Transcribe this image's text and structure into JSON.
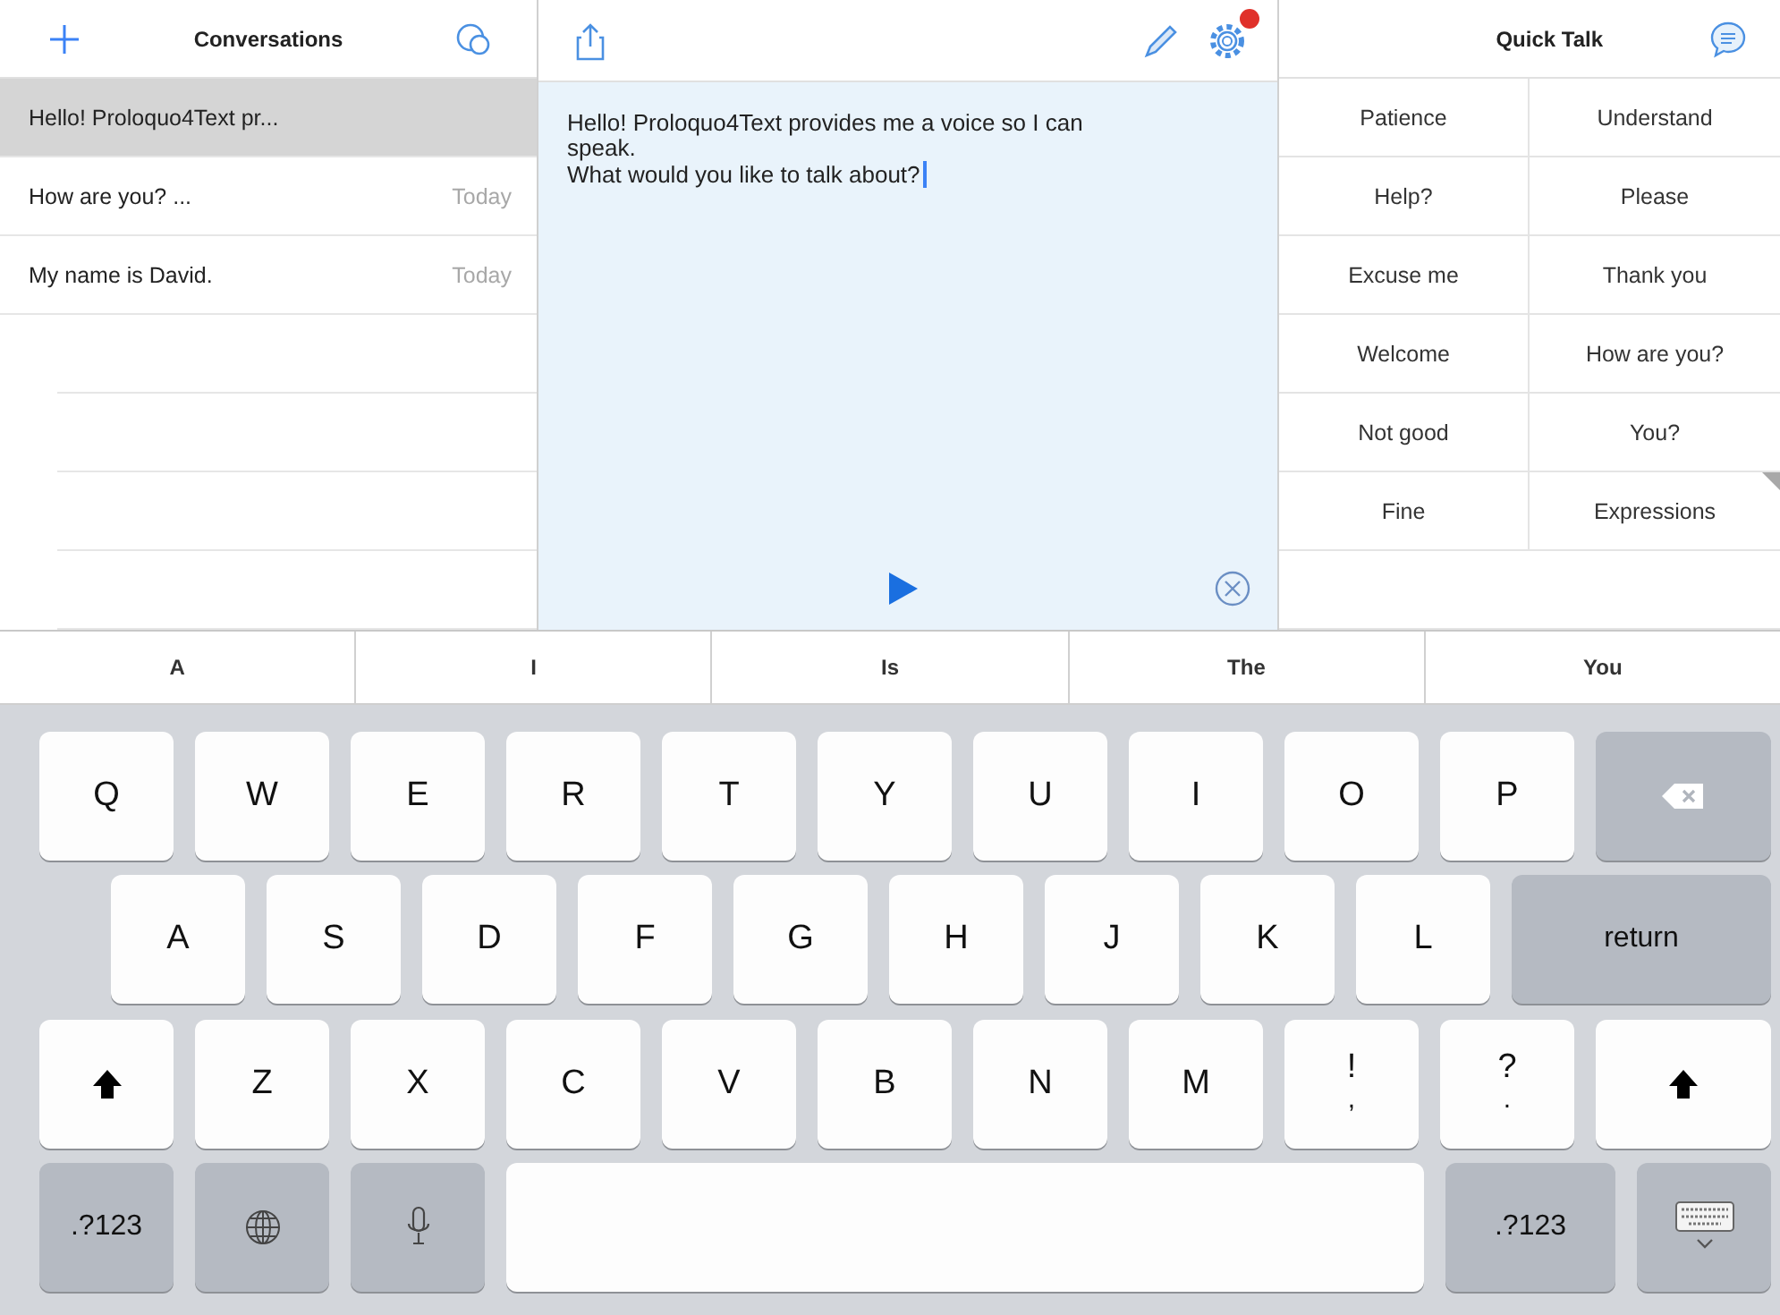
{
  "conversations_panel": {
    "title": "Conversations",
    "items": [
      {
        "text": "Hello! Proloquo4Text pr...",
        "selected": true
      },
      {
        "text": "How are you? ...",
        "date": "Today",
        "selected": false
      },
      {
        "text": "My name is David.",
        "date": "Today",
        "selected": false
      }
    ]
  },
  "editor": {
    "lines": [
      "Hello! Proloquo4Text provides me a voice so I can speak.",
      "What would you like to talk about?"
    ],
    "settings_badge": true
  },
  "quick_talk": {
    "title": "Quick Talk",
    "items": [
      {
        "label": "Patience",
        "kind": "phrase"
      },
      {
        "label": "Understand",
        "kind": "phrase"
      },
      {
        "label": "Help?",
        "kind": "phrase"
      },
      {
        "label": "Please",
        "kind": "phrase"
      },
      {
        "label": "Excuse me",
        "kind": "phrase"
      },
      {
        "label": "Thank you",
        "kind": "phrase"
      },
      {
        "label": "Welcome",
        "kind": "phrase"
      },
      {
        "label": "How are you?",
        "kind": "phrase"
      },
      {
        "label": "Not good",
        "kind": "phrase"
      },
      {
        "label": "You?",
        "kind": "phrase"
      },
      {
        "label": "Fine",
        "kind": "phrase"
      },
      {
        "label": "Expressions",
        "kind": "category"
      }
    ]
  },
  "suggestions": [
    "A",
    "I",
    "Is",
    "The",
    "You"
  ],
  "keyboard": {
    "rows": [
      {
        "keys": [
          {
            "kind": "letter",
            "label": "Q"
          },
          {
            "kind": "letter",
            "label": "W"
          },
          {
            "kind": "letter",
            "label": "E"
          },
          {
            "kind": "letter",
            "label": "R"
          },
          {
            "kind": "letter",
            "label": "T"
          },
          {
            "kind": "letter",
            "label": "Y"
          },
          {
            "kind": "letter",
            "label": "U"
          },
          {
            "kind": "letter",
            "label": "I"
          },
          {
            "kind": "letter",
            "label": "O"
          },
          {
            "kind": "letter",
            "label": "P"
          },
          {
            "kind": "delete"
          }
        ]
      },
      {
        "keys": [
          {
            "kind": "letter",
            "label": "A"
          },
          {
            "kind": "letter",
            "label": "S"
          },
          {
            "kind": "letter",
            "label": "D"
          },
          {
            "kind": "letter",
            "label": "F"
          },
          {
            "kind": "letter",
            "label": "G"
          },
          {
            "kind": "letter",
            "label": "H"
          },
          {
            "kind": "letter",
            "label": "J"
          },
          {
            "kind": "letter",
            "label": "K"
          },
          {
            "kind": "letter",
            "label": "L"
          },
          {
            "kind": "return",
            "label": "return"
          }
        ]
      },
      {
        "keys": [
          {
            "kind": "shift"
          },
          {
            "kind": "letter",
            "label": "Z"
          },
          {
            "kind": "letter",
            "label": "X"
          },
          {
            "kind": "letter",
            "label": "C"
          },
          {
            "kind": "letter",
            "label": "V"
          },
          {
            "kind": "letter",
            "label": "B"
          },
          {
            "kind": "letter",
            "label": "N"
          },
          {
            "kind": "letter",
            "label": "M"
          },
          {
            "kind": "punct",
            "label": "!",
            "secondary": ","
          },
          {
            "kind": "punct",
            "label": "?",
            "secondary": "."
          },
          {
            "kind": "shift"
          }
        ]
      },
      {
        "keys": [
          {
            "kind": "symbols",
            "label": ".?123"
          },
          {
            "kind": "globe"
          },
          {
            "kind": "mic"
          },
          {
            "kind": "space"
          },
          {
            "kind": "symbols",
            "label": ".?123"
          },
          {
            "kind": "hide"
          }
        ]
      }
    ]
  }
}
